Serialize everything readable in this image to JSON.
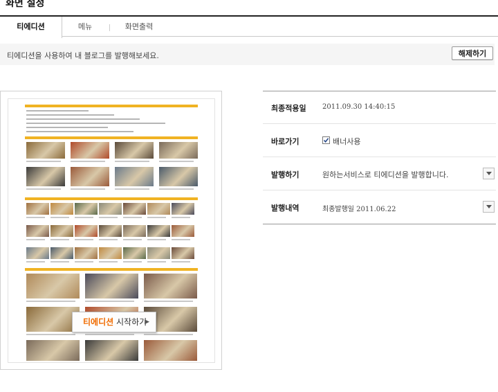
{
  "page_title": "화면 설정",
  "tabs": [
    {
      "label": "티에디션",
      "active": true
    },
    {
      "label": "메뉴",
      "active": false
    },
    {
      "label": "화면출력",
      "active": false
    }
  ],
  "notice": {
    "text": "티에디션을 사용하여 내 블로그를 발행해보세요.",
    "release_button": "해제하기"
  },
  "preview": {
    "start_button_highlight": "티에디션",
    "start_button_rest": " 시작하기",
    "accent_color": "#f0b323"
  },
  "settings": {
    "last_applied": {
      "label": "최종적용일",
      "value": "2011.09.30 14:40:15"
    },
    "shortcut": {
      "label": "바로가기",
      "checkbox_label": "배너사용",
      "checked": true
    },
    "publish": {
      "label": "발행하기",
      "value": "원하는서비스로 티에디션을 발행합니다."
    },
    "history": {
      "label": "발행내역",
      "value": "최종발행일 2011.06.22"
    }
  }
}
